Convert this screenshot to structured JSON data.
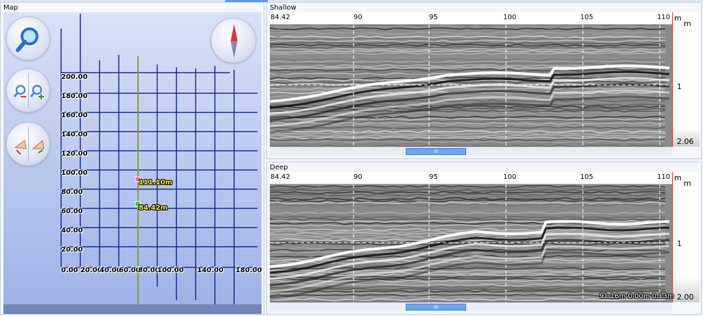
{
  "colors": {
    "grid_line": "#1b2a8a",
    "marker_start": "#2ecc40",
    "marker_end": "#ff6b6b",
    "marker_label": "#fff200",
    "accent": "#5c9ae8"
  },
  "map": {
    "title": "Map",
    "y_labels": [
      "200.00",
      "180.00",
      "160.00",
      "140.00",
      "120.00",
      "100.00",
      "80.00",
      "60.00",
      "40.00",
      "20.00"
    ],
    "x_labels": [
      "0.00",
      "20.00",
      "40.00",
      "60.00",
      "80.00",
      "100.00",
      "140.00",
      "180.00"
    ],
    "markers": [
      {
        "label": "111.10m",
        "color": "#ff6b6b"
      },
      {
        "label": "84.42m",
        "color": "#2ecc40"
      }
    ],
    "controls": {
      "search_icon": "magnifier-icon",
      "zoom_out_icon": "zoom-out-icon",
      "zoom_in_icon": "zoom-in-icon",
      "rotate_left_icon": "rotate-left-icon",
      "rotate_right_icon": "rotate-right-icon",
      "compass_icon": "compass-icon"
    }
  },
  "shallow": {
    "title": "Shallow",
    "x_ticks": [
      "84.42",
      "90",
      "95",
      "100",
      "105",
      "110"
    ],
    "unit_top": "m",
    "unit_right": "m",
    "depth_ticks": [
      "1",
      "2.06"
    ],
    "scroll_thumb": "III"
  },
  "deep": {
    "title": "Deep",
    "x_ticks": [
      "84.42",
      "90",
      "95",
      "100",
      "105",
      "110"
    ],
    "unit_top": "m",
    "unit_right": "m",
    "depth_ticks": [
      "1",
      "2.00"
    ],
    "scroll_thumb": "III",
    "readout": "91.16m 0.00m 0.13m"
  }
}
